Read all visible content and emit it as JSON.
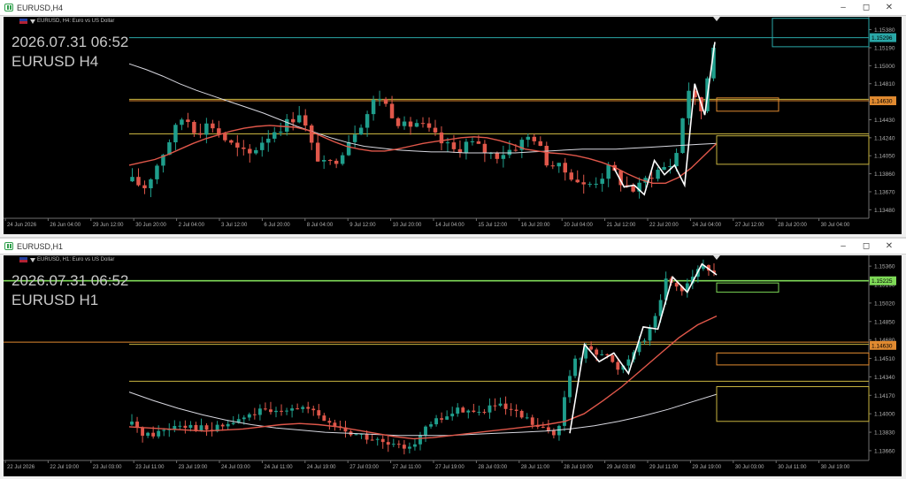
{
  "colors": {
    "bull": "#1f9e8c",
    "bear": "#e0574a",
    "ema": "#e0574a",
    "sma": "#d8d8e0",
    "zigzag": "#ffffff",
    "level_yellow": "#c8b440",
    "level_orange": "#e08a30",
    "level_cyan": "#2aa7a7",
    "level_green": "#7ed957",
    "axis_text": "#b0b0b0"
  },
  "windows": [
    {
      "id": "h4",
      "title": "EURUSD,H4",
      "datetime": "2026.07.31 06:52",
      "symbol_tf": "EURUSD H4",
      "sym_info": "EURUSD, H4:  Euro vs US Dollar",
      "price_labels": [
        "1.15380",
        "1.15190",
        "1.15000",
        "1.14810",
        "1.14620",
        "1.14430",
        "1.14240",
        "1.14050",
        "1.13860",
        "1.13670",
        "1.13480"
      ],
      "current_price": "1.15296",
      "level_price": "1.14630",
      "time_labels": [
        "24 Jun 2026",
        "26 Jun 04:00",
        "29 Jun 12:00",
        "30 Jun 20:00",
        "2 Jul 04:00",
        "3 Jul 12:00",
        "6 Jul 20:00",
        "8 Jul 04:00",
        "9 Jul 12:00",
        "10 Jul 20:00",
        "14 Jul 04:00",
        "15 Jul 12:00",
        "16 Jul 20:00",
        "20 Jul 04:00",
        "21 Jul 12:00",
        "22 Jul 20:00",
        "24 Jul 04:00",
        "27 Jul 12:00",
        "28 Jul 20:00",
        "30 Jul 04:00"
      ]
    },
    {
      "id": "h1",
      "title": "EURUSD,H1",
      "datetime": "2026.07.31 06:52",
      "symbol_tf": "EURUSD H1",
      "sym_info": "EURUSD, H1:  Euro vs US Dollar",
      "price_labels": [
        "1.15360",
        "1.15190",
        "1.15020",
        "1.14850",
        "1.14680",
        "1.14510",
        "1.14340",
        "1.14170",
        "1.14000",
        "1.13830",
        "1.13660"
      ],
      "current_price": "1.15225",
      "level_price": "1.14630",
      "time_labels": [
        "22 Jul 2026",
        "22 Jul 19:00",
        "23 Jul 03:00",
        "23 Jul 11:00",
        "23 Jul 19:00",
        "24 Jul 03:00",
        "24 Jul 11:00",
        "24 Jul 19:00",
        "27 Jul 03:00",
        "27 Jul 11:00",
        "27 Jul 19:00",
        "28 Jul 03:00",
        "28 Jul 11:00",
        "28 Jul 19:00",
        "29 Jul 03:00",
        "29 Jul 11:00",
        "29 Jul 19:00",
        "30 Jul 03:00",
        "30 Jul 11:00",
        "30 Jul 19:00"
      ]
    }
  ],
  "chart_data": [
    {
      "type": "candlestick",
      "symbol": "EURUSD",
      "timeframe": "H4",
      "ylim": [
        1.1339,
        1.1546
      ],
      "levels": [
        {
          "price": 1.1463,
          "color": "orange"
        },
        {
          "price": 1.14645,
          "color": "yellow"
        },
        {
          "price": 1.1428,
          "color": "yellow"
        },
        {
          "price": 1.15296,
          "color": "cyan"
        }
      ],
      "ema_shape": [
        1.1395,
        1.1398,
        1.1401,
        1.1406,
        1.1412,
        1.1418,
        1.1423,
        1.1427,
        1.1431,
        1.1434,
        1.1436,
        1.1437,
        1.1436,
        1.1435,
        1.1432,
        1.1426,
        1.142,
        1.1415,
        1.1412,
        1.141,
        1.141,
        1.1412,
        1.1415,
        1.1418,
        1.142,
        1.1422,
        1.1424,
        1.1425,
        1.1424,
        1.1421,
        1.1417,
        1.1412,
        1.141,
        1.1408,
        1.1407,
        1.1405,
        1.1402,
        1.1398,
        1.1393,
        1.1386,
        1.138,
        1.1376,
        1.1376,
        1.1382,
        1.1392,
        1.1405,
        1.1418
      ],
      "sma_shape": [
        1.1502,
        1.1496,
        1.1489,
        1.1481,
        1.1474,
        1.1468,
        1.1462,
        1.1456,
        1.145,
        1.1443,
        1.1436,
        1.143,
        1.1424,
        1.1419,
        1.1415,
        1.1413,
        1.1411,
        1.141,
        1.1409,
        1.1409,
        1.1408,
        1.1408,
        1.1408,
        1.1408,
        1.1409,
        1.141,
        1.1411,
        1.1412,
        1.1412,
        1.1412,
        1.1413,
        1.1414,
        1.1415,
        1.1416,
        1.1417,
        1.1418
      ],
      "zigzag": [
        1.1392,
        1.1372,
        1.1374,
        1.1364,
        1.14,
        1.1385,
        1.1395,
        1.1374,
        1.1481,
        1.1448,
        1.1525
      ],
      "boxes": [
        {
          "from": 1.1466,
          "to": 1.1452,
          "color": "orange"
        },
        {
          "from": 1.1426,
          "to": 1.1396,
          "color": "yellow"
        },
        {
          "from": 1.155,
          "to": 1.152,
          "color": "cyan"
        }
      ]
    },
    {
      "type": "candlestick",
      "symbol": "EURUSD",
      "timeframe": "H1",
      "ylim": [
        1.1357,
        1.1541
      ],
      "levels": [
        {
          "price": 1.15225,
          "color": "green"
        },
        {
          "price": 1.1466,
          "color": "orange"
        },
        {
          "price": 1.1464,
          "color": "yellow"
        },
        {
          "price": 1.143,
          "color": "yellow"
        }
      ],
      "ema_shape": [
        1.1388,
        1.1387,
        1.1386,
        1.1385,
        1.1384,
        1.1385,
        1.1386,
        1.1388,
        1.139,
        1.1391,
        1.139,
        1.1388,
        1.1385,
        1.1382,
        1.1379,
        1.1377,
        1.1378,
        1.138,
        1.1382,
        1.1384,
        1.1386,
        1.1388,
        1.139,
        1.1393,
        1.14,
        1.1412,
        1.1425,
        1.144,
        1.1455,
        1.147,
        1.1482,
        1.149
      ],
      "sma_shape": [
        1.142,
        1.1412,
        1.1405,
        1.1399,
        1.1394,
        1.139,
        1.1387,
        1.1385,
        1.1383,
        1.1382,
        1.1381,
        1.138,
        1.138,
        1.138,
        1.1381,
        1.1382,
        1.1383,
        1.1384,
        1.1386,
        1.1389,
        1.1393,
        1.1398,
        1.1404,
        1.1411,
        1.1418
      ],
      "zigzag": [
        1.1382,
        1.1464,
        1.1448,
        1.1456,
        1.1437,
        1.148,
        1.1478,
        1.1526,
        1.1512,
        1.1538,
        1.1528
      ],
      "boxes": [
        {
          "from": 1.15205,
          "to": 1.1512,
          "color": "green"
        },
        {
          "from": 1.1456,
          "to": 1.1445,
          "color": "orange"
        },
        {
          "from": 1.1425,
          "to": 1.1393,
          "color": "yellow"
        }
      ]
    }
  ]
}
